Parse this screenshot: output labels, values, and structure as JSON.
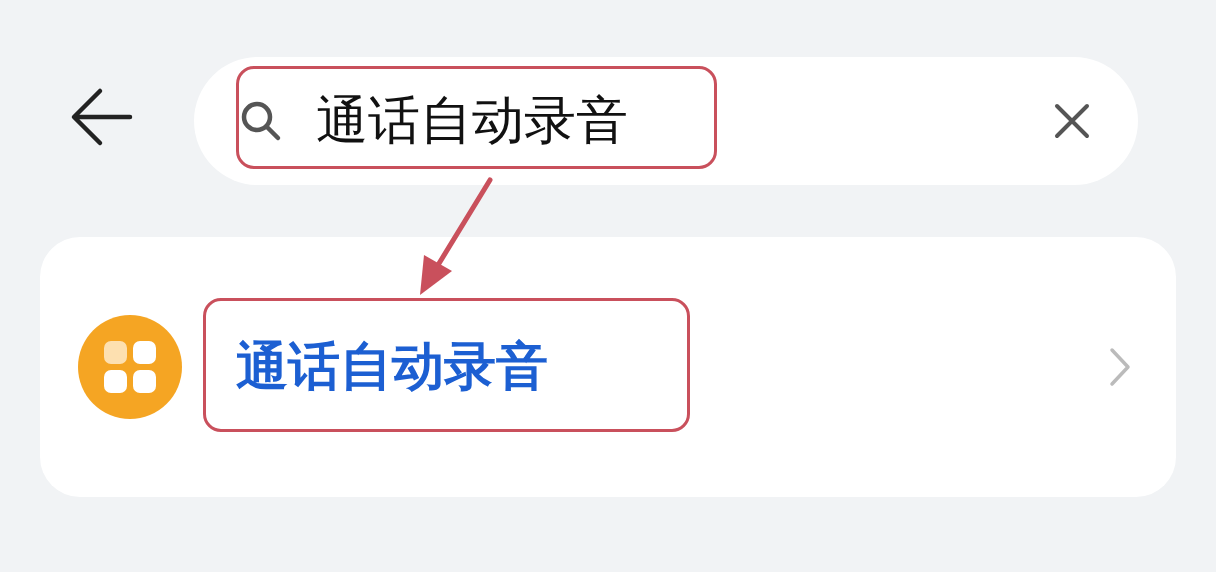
{
  "search": {
    "value": "通话自动录音"
  },
  "results": [
    {
      "title": "通话自动录音"
    }
  ]
}
